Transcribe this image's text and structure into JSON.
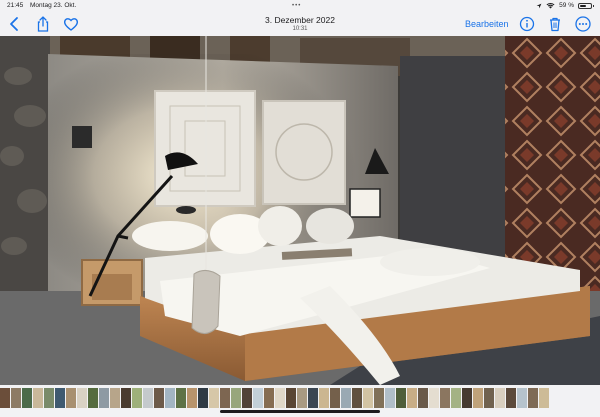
{
  "status_bar": {
    "time": "21:45",
    "date": "Montag 23. Okt.",
    "battery": "59 %",
    "battery_level": 0.59
  },
  "toolbar": {
    "title": "3. Dezember 2022",
    "subtitle": "10:31",
    "edit_label": "Bearbeiten",
    "accent": "#1a73e8",
    "icons": [
      "back-chevron-icon",
      "share-icon",
      "heart-icon",
      "info-icon",
      "trash-icon",
      "more-icon"
    ]
  },
  "thumbnail_strip": {
    "colors": [
      "#6b4e3a",
      "#8d7b65",
      "#4c6b4a",
      "#c9b89a",
      "#7a8b6a",
      "#3f5a70",
      "#a89070",
      "#d9d2c4",
      "#556b3e",
      "#8e9aa3",
      "#b7a58a",
      "#4a3b2f",
      "#9eb07a",
      "#c4c9cc",
      "#6d5a49",
      "#a3b5c2",
      "#5e7246",
      "#b8946c",
      "#2f3a44",
      "#d6c7a8",
      "#7d6651",
      "#98a67c",
      "#514238",
      "#c2cfd8",
      "#866d52",
      "#e0d8c8",
      "#5a4634",
      "#a99a82",
      "#3b4652",
      "#cbb690",
      "#74604b",
      "#9aa9b3",
      "#60503f",
      "#d2c3a3",
      "#807058",
      "#b0bec8",
      "#4f5e3a",
      "#c8ad86",
      "#6a5a4a",
      "#e4ddd0",
      "#8b7660",
      "#a4b284",
      "#463a30",
      "#bfa27a",
      "#71624f",
      "#d9cfbf",
      "#5c4a3b",
      "#b6c3cc",
      "#7e6a55",
      "#cdbb97"
    ]
  }
}
